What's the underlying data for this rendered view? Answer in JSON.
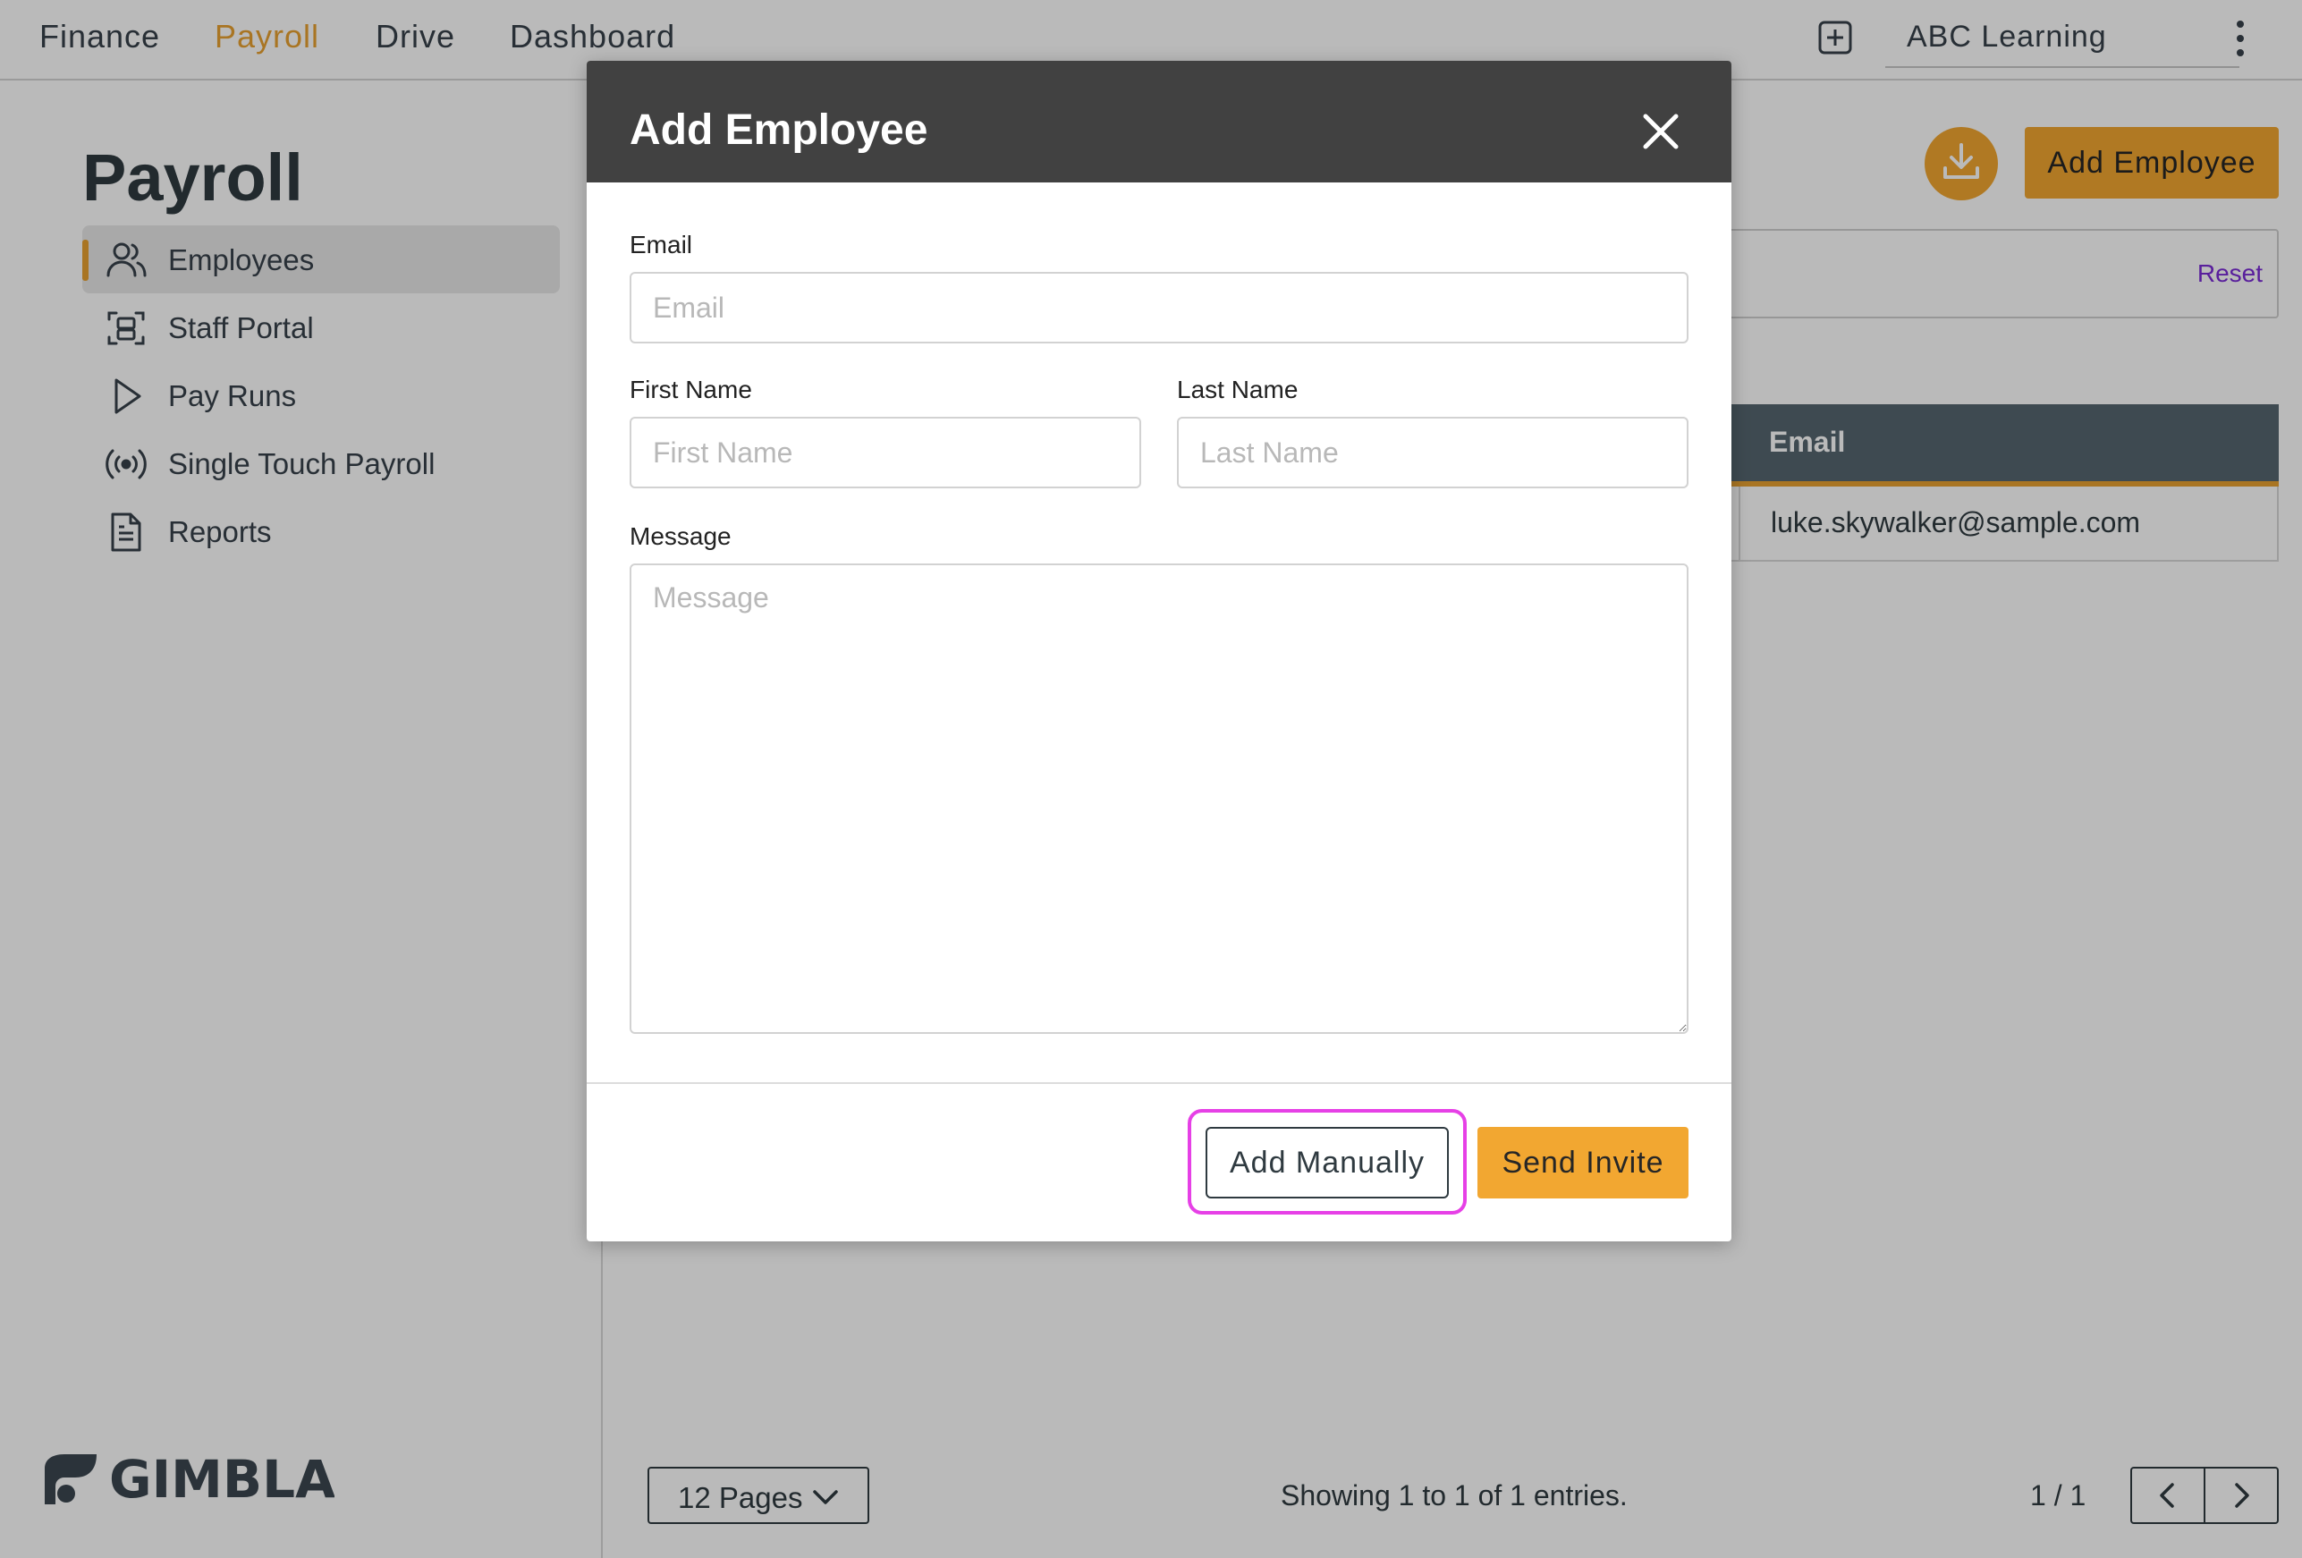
{
  "topnav": {
    "items": [
      {
        "label": "Finance",
        "active": false
      },
      {
        "label": "Payroll",
        "active": true
      },
      {
        "label": "Drive",
        "active": false
      },
      {
        "label": "Dashboard",
        "active": false
      }
    ],
    "org_name": "ABC Learning",
    "icons": {
      "add": "plus-square-icon",
      "menu": "kebab-menu-icon"
    }
  },
  "sidebar": {
    "title": "Payroll",
    "items": [
      {
        "label": "Employees",
        "icon": "users-icon",
        "active": true
      },
      {
        "label": "Staff Portal",
        "icon": "scan-frame-icon",
        "active": false
      },
      {
        "label": "Pay Runs",
        "icon": "play-icon",
        "active": false
      },
      {
        "label": "Single Touch Payroll",
        "icon": "broadcast-icon",
        "active": false
      },
      {
        "label": "Reports",
        "icon": "document-icon",
        "active": false
      }
    ],
    "brand": "GIMBLA"
  },
  "main": {
    "add_employee_label": "Add Employee",
    "download_icon": "download-icon",
    "filter": {
      "reset_label": "Reset"
    },
    "table": {
      "columns": [
        "Email"
      ],
      "rows": [
        {
          "email": "luke.skywalker@sample.com"
        }
      ]
    },
    "pagination": {
      "page_size_label": "12 Pages",
      "showing": "Showing 1 to 1 of 1 entries.",
      "page_count": "1 / 1"
    }
  },
  "modal": {
    "title": "Add Employee",
    "fields": {
      "email": {
        "label": "Email",
        "placeholder": "Email",
        "value": ""
      },
      "first_name": {
        "label": "First Name",
        "placeholder": "First Name",
        "value": ""
      },
      "last_name": {
        "label": "Last Name",
        "placeholder": "Last Name",
        "value": ""
      },
      "message": {
        "label": "Message",
        "placeholder": "Message",
        "value": ""
      }
    },
    "buttons": {
      "add_manually": "Add Manually",
      "send_invite": "Send Invite"
    }
  },
  "colors": {
    "accent": "#f2a731",
    "active_nav": "#e8a130",
    "header_dark": "#414141",
    "table_header": "#556670",
    "highlight": "#e640e6",
    "link": "#7a2bd6"
  }
}
